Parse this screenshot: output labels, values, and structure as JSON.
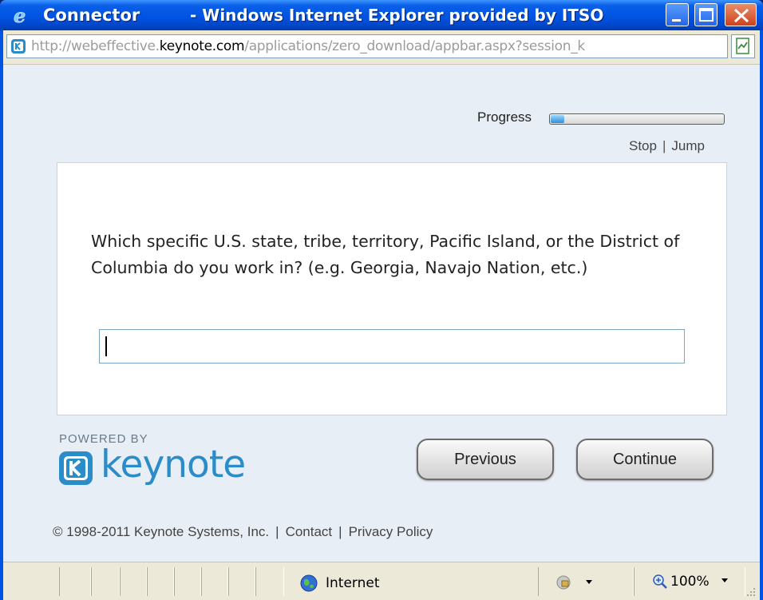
{
  "window": {
    "app_name": "Connector",
    "title_rest": "- Windows Internet Explorer provided by ITSO",
    "app_icon": "internet-explorer-icon"
  },
  "address_bar": {
    "url_prefix": "http://webeffective.",
    "url_domain": "keynote.com",
    "url_suffix": "/applications/zero_download/appbar.aspx?session_k"
  },
  "survey": {
    "progress_label": "Progress",
    "progress_value": 0.08,
    "stop_label": "Stop",
    "separator": "|",
    "jump_label": "Jump",
    "question": "Which specific U.S. state, tribe, territory, Pacific Island, or the District of Columbia do you work in? (e.g. Georgia, Navajo Nation, etc.)",
    "answer_value": "",
    "previous_label": "Previous",
    "continue_label": "Continue"
  },
  "branding": {
    "powered_by": "POWERED BY",
    "logo_text": "keynote",
    "accent_color": "#2a8cc8"
  },
  "footer": {
    "copyright": "© 1998-2011 Keynote Systems, Inc.",
    "separator": "|",
    "contact_label": "Contact",
    "privacy_label": "Privacy Policy"
  },
  "status_bar": {
    "zone_label": "Internet",
    "zoom_label": "100%"
  }
}
